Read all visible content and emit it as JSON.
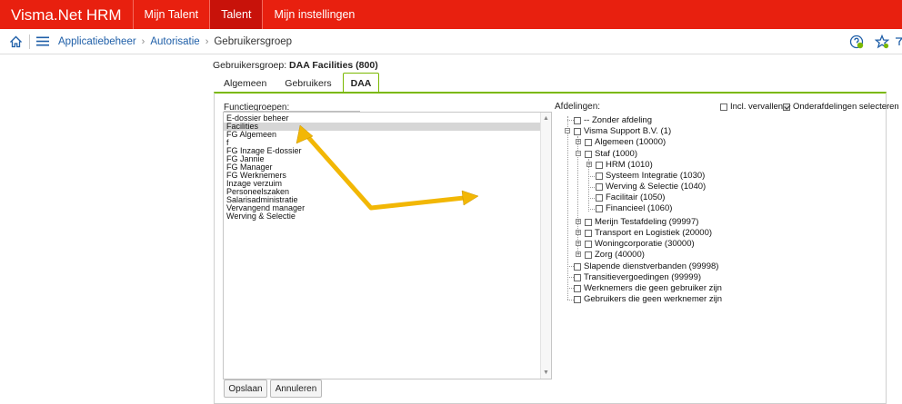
{
  "app": {
    "brand": "Visma.Net HRM",
    "nav": [
      "Mijn Talent",
      "Talent",
      "Mijn instellingen"
    ]
  },
  "breadcrumb": [
    "Applicatiebeheer",
    "Autorisatie",
    "Gebruikersgroep"
  ],
  "page": {
    "heading_label": "Gebruikersgroep:",
    "heading_value": "DAA Facilities (800)"
  },
  "tabs": [
    "Algemeen",
    "Gebruikers",
    "DAA"
  ],
  "functiegroepen": {
    "label": "Functiegroepen:",
    "items": [
      "E-dossier beheer",
      "Facilities",
      "FG Algemeen",
      "f",
      "FG Inzage E-dossier",
      "FG Jannie",
      "FG Manager",
      "FG Werknemers",
      "Inzage verzuim",
      "Personeelszaken",
      "Salarisadministratie",
      "Vervangend manager",
      "Werving & Selectie"
    ],
    "selected": "Facilities"
  },
  "afdelingen": {
    "label": "Afdelingen:",
    "incl_vervallen": "Incl. vervallen",
    "onderafdelingen": "Onderafdelingen selecteren",
    "tree": [
      "-- Zonder afdeling",
      "Visma Support B.V. (1)",
      "Algemeen (10000)",
      "Staf (1000)",
      "HRM (1010)",
      "Systeem Integratie (1030)",
      "Werving & Selectie (1040)",
      "Facilitair (1050)",
      "Financieel (1060)",
      "Merijn Testafdeling (99997)",
      "Transport en Logistiek (20000)",
      "Woningcorporatie (30000)",
      "Zorg (40000)",
      "Slapende dienstverbanden (99998)",
      "Transitievergoedingen (99999)",
      "Werknemers die geen gebruiker zijn",
      "Gebruikers die geen werknemer zijn"
    ]
  },
  "buttons": {
    "save": "Opslaan",
    "cancel": "Annuleren"
  },
  "icons": {
    "home": "home-icon",
    "menu": "hamburger-menu-icon",
    "help": "help-icon",
    "favorite": "favorite-star-icon",
    "annotation": "yellow-arrow-annotation"
  },
  "colors": {
    "topbar": "#e8200f",
    "accent_green": "#7ab800",
    "link_blue": "#1f5fa8",
    "arrow_yellow": "#f2b705"
  }
}
